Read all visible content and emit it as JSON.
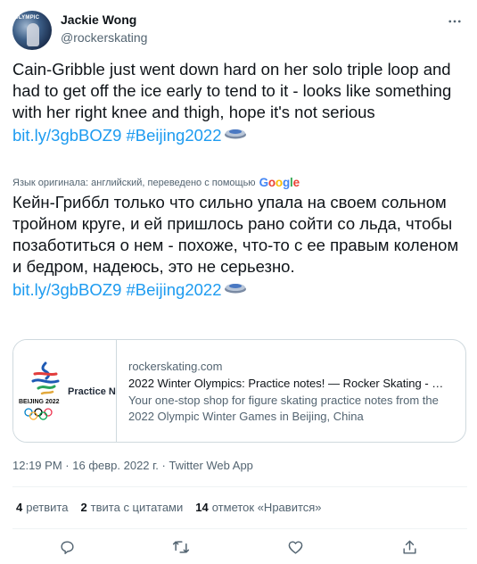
{
  "author": {
    "name": "Jackie Wong",
    "handle": "@rockerskating",
    "avatar_text": "OLYMPIC"
  },
  "tweet": {
    "text": "Cain-Gribble just went down hard on her solo triple loop and had to get off the ice early to tend to it - looks like something with her right knee and thigh, hope it's not serious",
    "link": "bit.ly/3gbBOZ9",
    "hashtag": "#Beijing2022"
  },
  "translation": {
    "label": "Язык оригинала: английский, переведено с помощью",
    "provider_logo_letters": [
      "G",
      "o",
      "o",
      "g",
      "l",
      "e"
    ],
    "text": "Кейн-Гриббл только что сильно упала на своем сольном тройном круге, и ей пришлось рано сойти со льда, чтобы позаботиться о нем - похоже, что-то с ее правым коленом и бедром, надеюсь, это не серьезно.",
    "link": "bit.ly/3gbBOZ9",
    "hashtag": "#Beijing2022"
  },
  "card": {
    "thumb_brand": "BEIJING 2022",
    "thumb_title": "Practice Notes",
    "domain": "rockerskating.com",
    "title": "2022 Winter Olympics: Practice notes! — Rocker Skating - …",
    "description": "Your one-stop shop for figure skating practice notes from the 2022 Olympic Winter Games in Beijing, China"
  },
  "meta": {
    "time": "12:19 PM",
    "separator": "·",
    "date": "16 февр. 2022 г.",
    "source": "Twitter Web App"
  },
  "stats": [
    {
      "count": "4",
      "label": "ретвита"
    },
    {
      "count": "2",
      "label": "твита с цитатами"
    },
    {
      "count": "14",
      "label": "отметок «Нравится»"
    }
  ],
  "icons": {
    "more": "more-horizontal-icon",
    "reply": "reply-icon",
    "retweet": "retweet-icon",
    "like": "heart-icon",
    "share": "share-icon",
    "hashtag_emoji": "curling-stone-emoji-icon"
  },
  "colors": {
    "link": "#1d9bf0",
    "text": "#0f1419",
    "secondary": "#536471",
    "border": "#cfd9de"
  }
}
